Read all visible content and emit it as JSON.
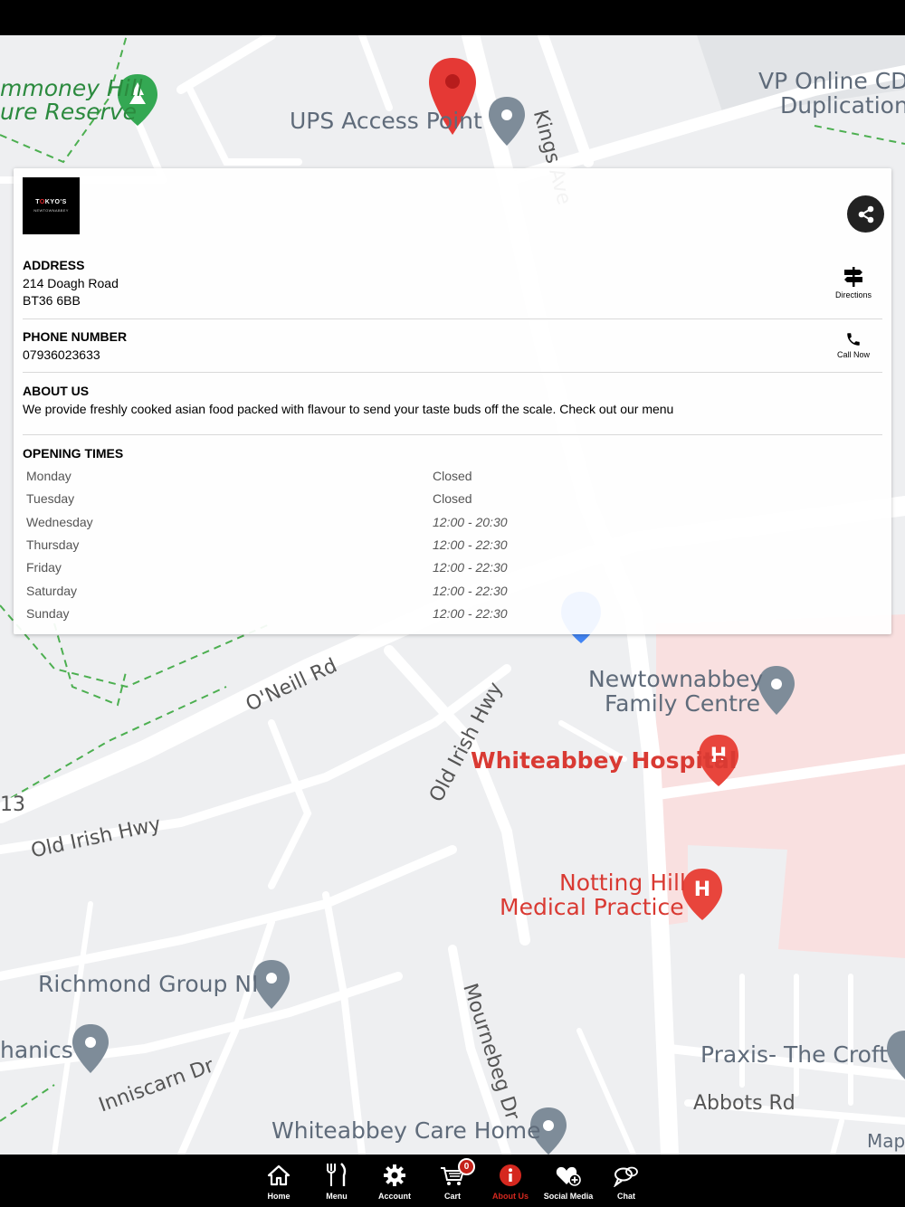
{
  "map": {
    "labels": [
      {
        "id": "reserve-1",
        "text": "mmoney Hill",
        "cls": "park"
      },
      {
        "id": "reserve-2",
        "text": "ure Reserve",
        "cls": "park"
      },
      {
        "id": "ups",
        "text": "UPS Access Point",
        "cls": ""
      },
      {
        "id": "kings",
        "text": "Kings Ave",
        "cls": "road"
      },
      {
        "id": "vp1",
        "text": "VP Online CD",
        "cls": ""
      },
      {
        "id": "vp2",
        "text": "Duplication",
        "cls": ""
      },
      {
        "id": "oneill",
        "text": "O'Neill Rd",
        "cls": "road"
      },
      {
        "id": "oldirish1",
        "text": "Old Irish Hwy",
        "cls": "road"
      },
      {
        "id": "oldirish2",
        "text": "Old Irish Hwy",
        "cls": "road"
      },
      {
        "id": "newtown1",
        "text": "Newtownabbey",
        "cls": ""
      },
      {
        "id": "newtown2",
        "text": "Family Centre",
        "cls": ""
      },
      {
        "id": "hospital",
        "text": "Whiteabbey Hospital",
        "cls": "poi-red"
      },
      {
        "id": "notting1",
        "text": "Notting Hill",
        "cls": "poi-red"
      },
      {
        "id": "notting2",
        "text": "Medical Practice",
        "cls": "poi-red"
      },
      {
        "id": "richmond",
        "text": "Richmond Group NI",
        "cls": ""
      },
      {
        "id": "hanics",
        "text": "hanics",
        "cls": ""
      },
      {
        "id": "inniscarn",
        "text": "Inniscarn Dr",
        "cls": "road"
      },
      {
        "id": "mournebeg",
        "text": "Mournebeg Dr",
        "cls": "road"
      },
      {
        "id": "praxis",
        "text": "Praxis- The Croft",
        "cls": ""
      },
      {
        "id": "abbots",
        "text": "Abbots Rd",
        "cls": "road"
      },
      {
        "id": "carehome",
        "text": "Whiteabbey Care Home",
        "cls": ""
      },
      {
        "id": "maps",
        "text": "Map",
        "cls": ""
      },
      {
        "id": "b13",
        "text": "13",
        "cls": "road"
      }
    ]
  },
  "card": {
    "logo": {
      "line1_a": "T",
      "line1_o": "O",
      "line1_b": "KYO'S",
      "line2": "NEWTOWNABBEY"
    },
    "address": {
      "title": "ADDRESS",
      "line1": "214 Doagh Road",
      "line2": "BT36 6BB",
      "action": "Directions"
    },
    "phone": {
      "title": "PHONE NUMBER",
      "number": "07936023633",
      "action": "Call Now"
    },
    "about": {
      "title": "ABOUT US",
      "text": "We provide freshly cooked asian food packed with flavour to send your taste buds off the scale. Check out our menu"
    },
    "hours": {
      "title": "OPENING TIMES",
      "rows": [
        {
          "day": "Monday",
          "time": "Closed",
          "italic": false
        },
        {
          "day": "Tuesday",
          "time": "Closed",
          "italic": false
        },
        {
          "day": "Wednesday",
          "time": "12:00 - 20:30",
          "italic": true
        },
        {
          "day": "Thursday",
          "time": "12:00 - 22:30",
          "italic": true
        },
        {
          "day": "Friday",
          "time": "12:00 - 22:30",
          "italic": true
        },
        {
          "day": "Saturday",
          "time": "12:00 - 22:30",
          "italic": true
        },
        {
          "day": "Sunday",
          "time": "12:00 - 22:30",
          "italic": true
        }
      ]
    }
  },
  "tabbar": {
    "tabs": [
      {
        "id": "home",
        "label": "Home",
        "icon": "home-icon"
      },
      {
        "id": "menu",
        "label": "Menu",
        "icon": "cutlery-icon"
      },
      {
        "id": "account",
        "label": "Account",
        "icon": "gear-icon"
      },
      {
        "id": "cart",
        "label": "Cart",
        "icon": "cart-icon"
      },
      {
        "id": "about",
        "label": "About Us",
        "icon": "info-icon"
      },
      {
        "id": "social",
        "label": "Social Media",
        "icon": "heart-plus-icon"
      },
      {
        "id": "chat",
        "label": "Chat",
        "icon": "chat-icon"
      }
    ],
    "cart_count": "0",
    "active": "about"
  },
  "colors": {
    "accent": "#d5281f",
    "badge": "#c4221a",
    "hospital": "#d93a33",
    "park": "#2b8a3e"
  }
}
